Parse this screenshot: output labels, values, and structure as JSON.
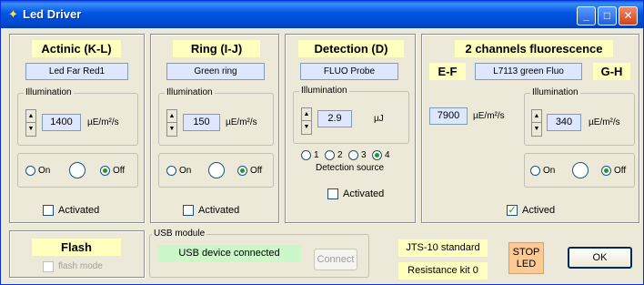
{
  "window": {
    "title": "Led Driver",
    "title_icon": "bulb-icon"
  },
  "actinic": {
    "header": "Actinic  (K-L)",
    "led": "Led Far Red1",
    "illumination_label": "Illumination",
    "value": "1400",
    "unit": "µE/m²/s",
    "radio_on": "On",
    "radio_off": "Off",
    "selected": "Off",
    "activated_label": "Activated",
    "activated": false
  },
  "ring": {
    "header": "Ring (I-J)",
    "led": "Green ring",
    "illumination_label": "Illumination",
    "value": "150",
    "unit": "µE/m²/s",
    "radio_on": "On",
    "radio_off": "Off",
    "selected": "Off",
    "activated_label": "Activated",
    "activated": false
  },
  "detection": {
    "header": "Detection (D)",
    "led": "FLUO Probe",
    "illumination_label": "Illumination",
    "value": "2.9",
    "unit": "µJ",
    "sources": [
      "1",
      "2",
      "3",
      "4"
    ],
    "selected_source": "4",
    "source_label": "Detection source",
    "activated_label": "Activated",
    "activated": false
  },
  "fluo": {
    "header": "2 channels fluorescence",
    "left_channel": "E-F",
    "right_channel": "G-H",
    "led": "L7113 green Fluo",
    "left_value": "7900",
    "left_unit": "µE/m²/s",
    "illumination_label": "Illumination",
    "right_value": "340",
    "right_unit": "µE/m²/s",
    "radio_on": "On",
    "radio_off": "Off",
    "selected": "Off",
    "actived_label": "Actived",
    "actived": true
  },
  "flash": {
    "header": "Flash",
    "mode_label": "flash mode"
  },
  "usb": {
    "group_title": "USB module",
    "status": "USB device connected",
    "status_color": "#ccf7c8",
    "connect_label": "Connect"
  },
  "standard": {
    "jts": "JTS-10 standard",
    "kit": "Resistance kit 0"
  },
  "stop_led": {
    "line1": "STOP",
    "line2": "LED",
    "color": "#ffc994"
  },
  "ok_label": "OK"
}
